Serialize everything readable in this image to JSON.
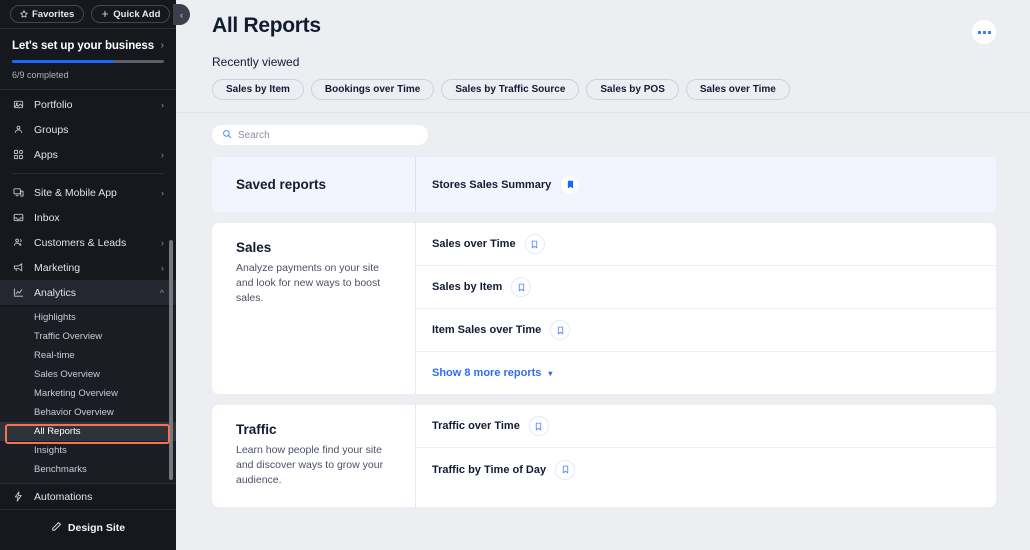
{
  "sidebar": {
    "top_buttons": [
      {
        "label": "Favorites",
        "icon": "star-icon"
      },
      {
        "label": "Quick Add",
        "icon": "plus-icon"
      }
    ],
    "setup": {
      "title": "Let's set up your business",
      "progress_label": "6/9 completed",
      "progress_percent": 67,
      "accent": "#1668ff"
    },
    "nav_groups": [
      {
        "items": [
          {
            "label": "Portfolio",
            "icon": "image-icon",
            "expandable": true
          },
          {
            "label": "Groups",
            "icon": "groups-icon",
            "expandable": false
          },
          {
            "label": "Apps",
            "icon": "apps-icon",
            "expandable": true
          }
        ]
      },
      {
        "items": [
          {
            "label": "Site & Mobile App",
            "icon": "monitor-icon",
            "expandable": true
          },
          {
            "label": "Inbox",
            "icon": "inbox-icon",
            "expandable": false
          },
          {
            "label": "Customers & Leads",
            "icon": "people-icon",
            "expandable": true
          },
          {
            "label": "Marketing",
            "icon": "megaphone-icon",
            "expandable": true
          },
          {
            "label": "Analytics",
            "icon": "chart-icon",
            "expandable": true,
            "expanded": true,
            "active": true
          }
        ]
      }
    ],
    "analytics_subitems": [
      {
        "label": "Highlights",
        "selected": false
      },
      {
        "label": "Traffic Overview",
        "selected": false
      },
      {
        "label": "Real-time",
        "selected": false
      },
      {
        "label": "Sales Overview",
        "selected": false
      },
      {
        "label": "Marketing Overview",
        "selected": false
      },
      {
        "label": "Behavior Overview",
        "selected": false
      },
      {
        "label": "All Reports",
        "selected": true
      },
      {
        "label": "Insights",
        "selected": false
      },
      {
        "label": "Benchmarks",
        "selected": false
      }
    ],
    "bottom_items": [
      {
        "label": "Automations",
        "icon": "automations-icon"
      }
    ],
    "design_site": {
      "label": "Design Site",
      "icon": "pencil-icon"
    },
    "collapse_icon": "chevron-left-icon",
    "highlight_color": "#f8714f"
  },
  "main": {
    "title": "All Reports",
    "more_icon": "ellipsis-icon",
    "recently_viewed_label": "Recently viewed",
    "recent_chips": [
      "Sales by Item",
      "Bookings over Time",
      "Sales by Traffic Source",
      "Sales by POS",
      "Sales over Time"
    ],
    "search": {
      "placeholder": "Search",
      "value": "",
      "icon": "search-icon"
    },
    "saved_section": {
      "title": "Saved reports",
      "items": [
        {
          "name": "Stores Sales Summary",
          "bookmarked": true,
          "icon": "bookmark-filled-icon"
        }
      ]
    },
    "sections": [
      {
        "title": "Sales",
        "description": "Analyze payments on your site and look for new ways to boost sales.",
        "reports": [
          {
            "name": "Sales over Time",
            "icon": "bookmark-outline-icon"
          },
          {
            "name": "Sales by Item",
            "icon": "bookmark-outline-icon"
          },
          {
            "name": "Item Sales over Time",
            "icon": "bookmark-outline-icon"
          }
        ],
        "show_more_label": "Show 8 more reports",
        "show_more_icon": "chevron-down-icon"
      },
      {
        "title": "Traffic",
        "description": "Learn how people find your site and discover ways to grow your audience.",
        "reports": [
          {
            "name": "Traffic over Time",
            "icon": "bookmark-outline-icon"
          },
          {
            "name": "Traffic by Time of Day",
            "icon": "bookmark-outline-icon"
          }
        ]
      }
    ]
  }
}
